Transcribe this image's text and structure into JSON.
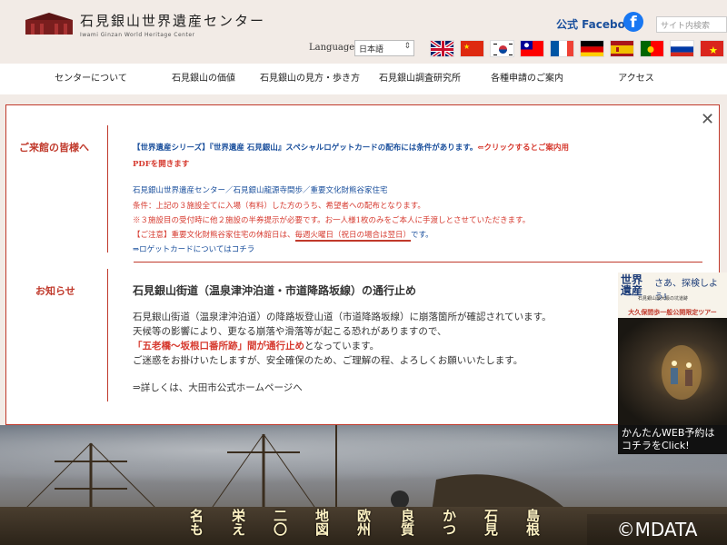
{
  "header": {
    "logo_ja": "石見銀山世界遺産センター",
    "logo_en": "Iwami Ginzan World Heritage Center",
    "facebook_label": "公式 Facebook",
    "search_placeholder": "サイト内検索",
    "language_label": "Language :",
    "language_selected": "日本語",
    "flags": [
      "uk-flag",
      "china-flag",
      "korea-flag",
      "taiwan-flag",
      "france-flag",
      "germany-flag",
      "spain-flag",
      "portugal-flag",
      "russia-flag",
      "vietnam-flag"
    ]
  },
  "nav": {
    "items": [
      "センターについて",
      "石見銀山の価値",
      "石見銀山の見方・歩き方",
      "石見銀山調査研究所",
      "各種申請のご案内",
      "アクセス"
    ]
  },
  "notice": {
    "visitors_title": "ご来館の皆様へ",
    "line1_a": "【世界遺産シリーズ】『世界遺産 石見銀山』スペシャルロゲットカードの配布には条件があります。",
    "line1_b": "⇐クリックするとご案内用",
    "line2": "PDFを開きます",
    "line3": "石見銀山世界遺産センター／石見銀山龍源寺間歩／重要文化財熊谷家住宅",
    "line4": "条件：上記の３施設全てに入場（有料）した方のうち、希望者への配布となります。",
    "line5": "※３施設目の受付時に他２施設の半券提示が必要です。お一人様1枚のみをご本人に手渡しとさせていただきます。",
    "line6_a": "【ご注意】重要文化財熊谷家住宅の休館日は、",
    "line6_b": "毎週火曜日（祝日の場合は翌日）",
    "line6_c": "です。",
    "line7": "⇒ロゲットカードについてはコチラ",
    "news_title": "お知らせ",
    "news_headline": "石見銀山街道（温泉津沖泊道・市道降路坂線）の通行止め",
    "news_p1": "石見銀山街道（温泉津沖泊道）の降路坂登山道（市道降路坂線）に崩落箇所が確認されています。",
    "news_p2": "天候等の影響により、更なる崩落や滑落等が起こる恐れがありますので、",
    "news_p3_red": "「五老橋〜坂根口番所跡」間が通行止め",
    "news_p3_rest": "となっています。",
    "news_p4": "ご迷惑をお掛けいたしますが、安全確保のため、ご理解の程、よろしくお願いいたします。",
    "news_link": "⇒詳しくは、大田市公式ホームページへ"
  },
  "hero": {
    "vertical_texts": [
      "名も",
      "栄え",
      "二〇",
      "地図",
      "欧州",
      "良質",
      "かつ",
      "石見",
      "島根"
    ]
  },
  "side_banner": {
    "kanji": "世界遺産",
    "catch": "さあ、探検しよう!",
    "sub": "石見銀山最大級の坑道跡",
    "band": "大久保間歩一般公開限定ツアー",
    "bottom_line1": "かんたんWEB予約は",
    "bottom_line2": "コチラをClick!"
  },
  "watermark": "©MDATA",
  "colors": {
    "accent_red": "#c0392b",
    "link_blue": "#1a4f9c",
    "page_bg": "#f2ebe6"
  }
}
